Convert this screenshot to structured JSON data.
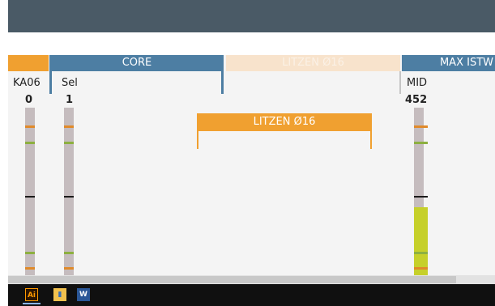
{
  "columns": {
    "core_label": "CORE",
    "litzen_label": "LITZEN Ø16",
    "max_label": "MAX ISTW"
  },
  "subheaders": {
    "ka06": "KA06",
    "sel": "Sel",
    "mid": "MID"
  },
  "values": {
    "ka06": "0",
    "sel": "1",
    "mid": "452"
  },
  "bracket": {
    "label": "LITZEN Ø16"
  },
  "taskbar": {
    "icons": [
      "illustrator-icon",
      "file-explorer-icon",
      "word-icon"
    ],
    "ai_label": "Ai",
    "word_label": "W"
  },
  "colors": {
    "titlebar": "#4a5a66",
    "header_blue": "#4d7ea3",
    "header_orange": "#f0a030",
    "marker_orange": "#e08a2a",
    "marker_green": "#8db040",
    "marker_black": "#1a1a1a",
    "level_lime": "#c6d02a"
  }
}
